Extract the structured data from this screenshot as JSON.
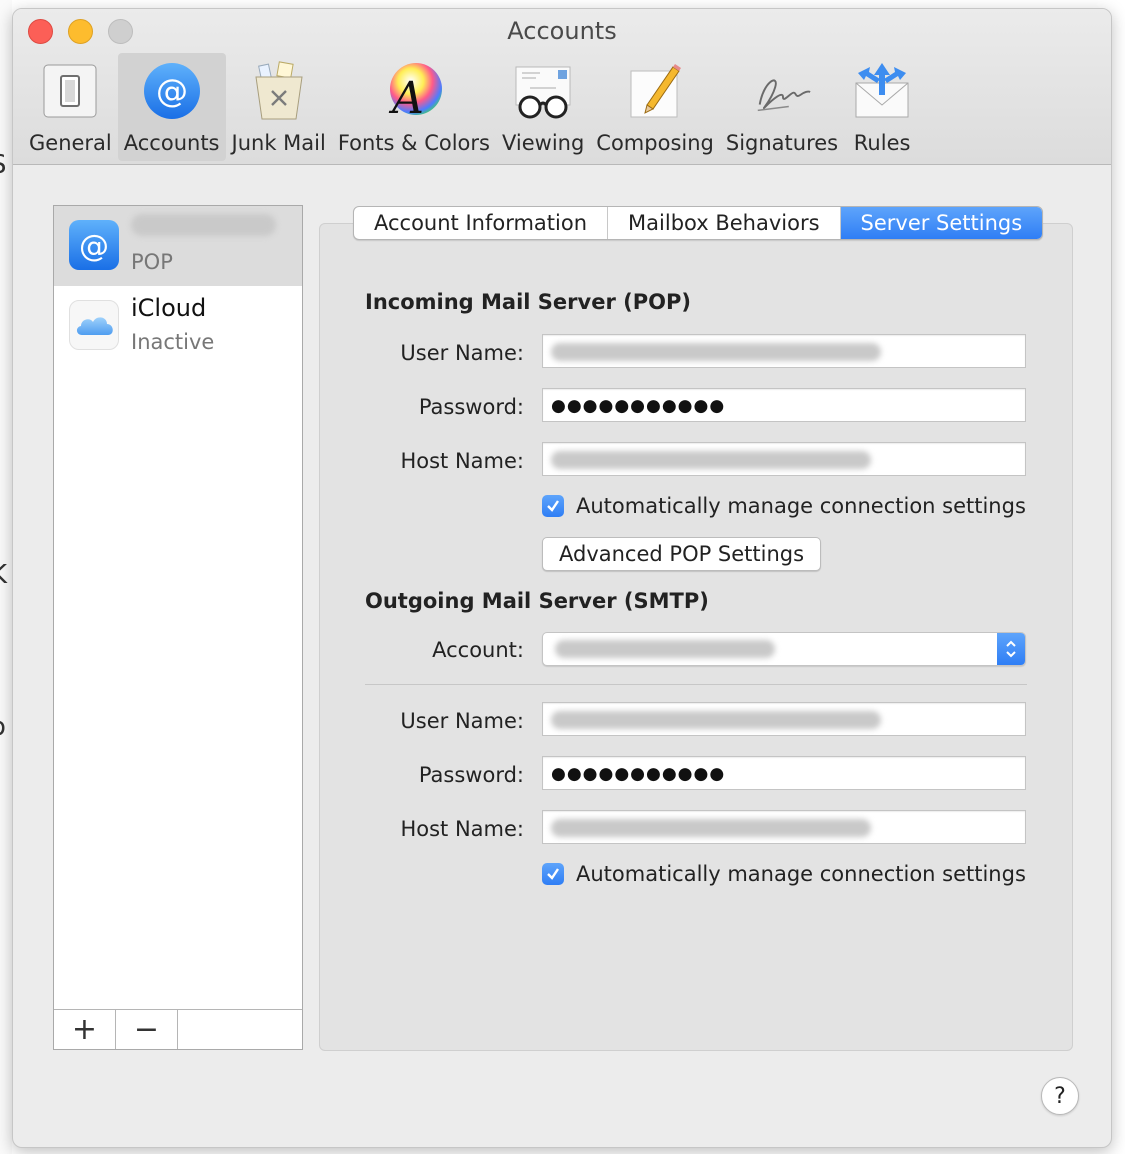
{
  "window": {
    "title": "Accounts"
  },
  "toolbar": {
    "items": [
      {
        "label": "General",
        "icon": "switch-icon",
        "active": false
      },
      {
        "label": "Accounts",
        "icon": "at-sign-icon",
        "active": true
      },
      {
        "label": "Junk Mail",
        "icon": "trash-can-icon",
        "active": false
      },
      {
        "label": "Fonts & Colors",
        "icon": "font-color-wheel-icon",
        "active": false
      },
      {
        "label": "Viewing",
        "icon": "glasses-icon",
        "active": false
      },
      {
        "label": "Composing",
        "icon": "pencil-paper-icon",
        "active": false
      },
      {
        "label": "Signatures",
        "icon": "signature-icon",
        "active": false
      },
      {
        "label": "Rules",
        "icon": "envelope-arrows-icon",
        "active": false
      }
    ]
  },
  "sidebar": {
    "accounts": [
      {
        "subtitle": "POP",
        "icon": "at-sign-icon",
        "selected": true
      },
      {
        "name": "iCloud",
        "subtitle": "Inactive",
        "icon": "cloud-icon",
        "selected": false
      }
    ],
    "footer": {
      "add_label": "+",
      "remove_label": "−"
    }
  },
  "tabs": [
    {
      "label": "Account Information",
      "active": false
    },
    {
      "label": "Mailbox Behaviors",
      "active": false
    },
    {
      "label": "Server Settings",
      "active": true
    }
  ],
  "incoming": {
    "title": "Incoming Mail Server (POP)",
    "user_name_label": "User Name:",
    "password_label": "Password:",
    "password_value": "●●●●●●●●●●●",
    "host_name_label": "Host Name:",
    "auto_manage_label": "Automatically manage connection settings",
    "auto_manage_checked": true,
    "advanced_button": "Advanced POP Settings"
  },
  "outgoing": {
    "title": "Outgoing Mail Server (SMTP)",
    "account_label": "Account:",
    "user_name_label": "User Name:",
    "password_label": "Password:",
    "password_value": "●●●●●●●●●●●",
    "host_name_label": "Host Name:",
    "auto_manage_label": "Automatically manage connection settings",
    "auto_manage_checked": true
  },
  "help": {
    "label": "?"
  },
  "colors": {
    "accent": "#2f7ef5",
    "accent_light": "#5ea4fb"
  }
}
